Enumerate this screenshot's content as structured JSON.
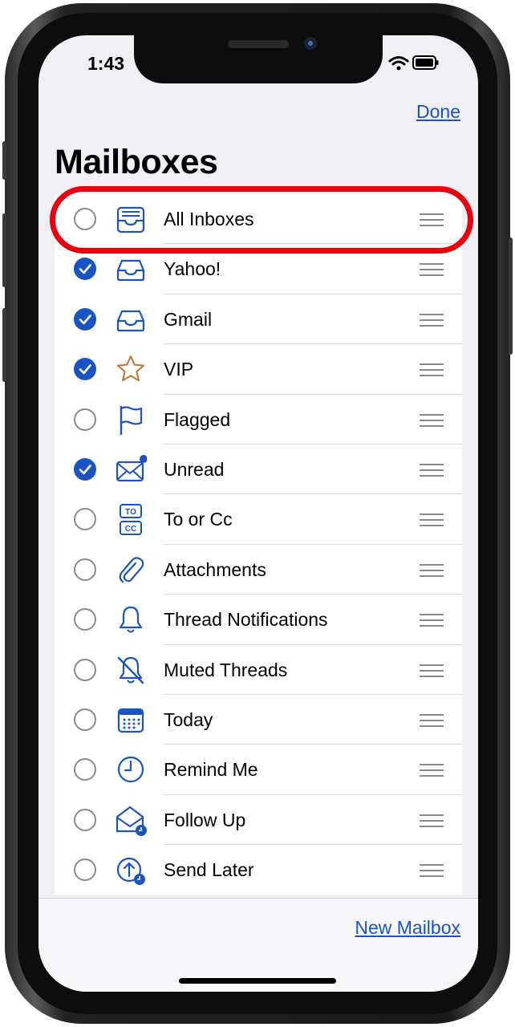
{
  "status_bar": {
    "time": "1:43",
    "icons": [
      "signal-icon",
      "wifi-icon",
      "battery-icon"
    ]
  },
  "header": {
    "done_label": "Done",
    "title": "Mailboxes"
  },
  "mailboxes": [
    {
      "label": "All Inboxes",
      "icon": "tray-stack-icon",
      "selected": false
    },
    {
      "label": "Yahoo!",
      "icon": "tray-icon",
      "selected": true
    },
    {
      "label": "Gmail",
      "icon": "tray-icon",
      "selected": true
    },
    {
      "label": "VIP",
      "icon": "star-icon",
      "selected": true
    },
    {
      "label": "Flagged",
      "icon": "flag-icon",
      "selected": false
    },
    {
      "label": "Unread",
      "icon": "envelope-badge-icon",
      "selected": true
    },
    {
      "label": "To or Cc",
      "icon": "to-cc-icon",
      "selected": false
    },
    {
      "label": "Attachments",
      "icon": "paperclip-icon",
      "selected": false
    },
    {
      "label": "Thread Notifications",
      "icon": "bell-icon",
      "selected": false
    },
    {
      "label": "Muted Threads",
      "icon": "bell-slash-icon",
      "selected": false
    },
    {
      "label": "Today",
      "icon": "calendar-icon",
      "selected": false
    },
    {
      "label": "Remind Me",
      "icon": "clock-icon",
      "selected": false
    },
    {
      "label": "Follow Up",
      "icon": "envelope-open-clock-icon",
      "selected": false
    },
    {
      "label": "Send Later",
      "icon": "arrow-clock-icon",
      "selected": false
    }
  ],
  "footer": {
    "new_mailbox_label": "New Mailbox"
  },
  "colors": {
    "accent": "#1a53c4",
    "highlight": "#e8000f",
    "star": "#c2742e"
  }
}
